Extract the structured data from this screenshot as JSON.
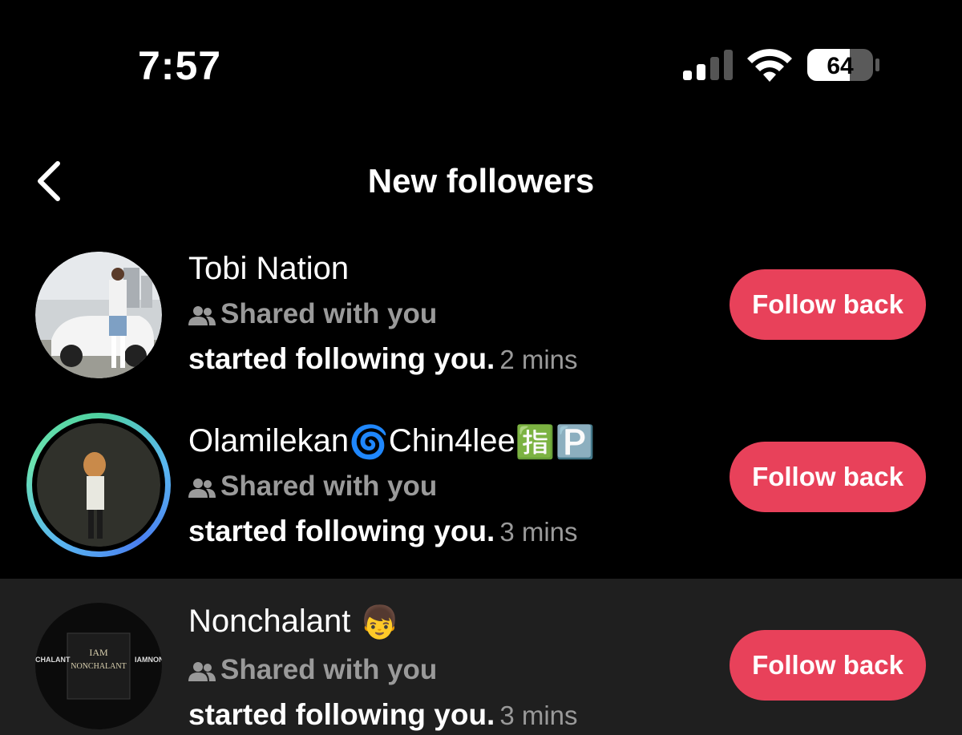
{
  "status_bar": {
    "time": "7:57",
    "battery_level": "64",
    "signal_icon": "cellular-signal-icon",
    "wifi_icon": "wifi-icon"
  },
  "header": {
    "title": "New followers",
    "back_icon": "chevron-left-icon"
  },
  "followers": [
    {
      "name": "Tobi Nation",
      "shared_label": "Shared with you",
      "activity": "started following you.",
      "time_ago": "2 mins",
      "button_label": "Follow back"
    },
    {
      "name": "Olamilekan",
      "name_emoji_1": "🌀",
      "name_part_2": "Chin4lee",
      "name_emoji_2": "🈯",
      "name_emoji_3": "🅿️",
      "shared_label": "Shared with you",
      "activity": "started following you.",
      "time_ago": "3 mins",
      "button_label": "Follow back"
    },
    {
      "name": "Nonchalant",
      "name_emoji_1": "👦",
      "shared_label": "Shared with you",
      "activity": "started following you.",
      "time_ago": "3 mins",
      "button_label": "Follow back",
      "avatar_text_1": "IAM",
      "avatar_text_2": "NONCHALANT",
      "avatar_text_left": "CHALANT",
      "avatar_text_right": "IAMNONI"
    }
  ],
  "colors": {
    "accent": "#e8415a",
    "background": "#000000",
    "highlight_row": "#1f1f1f",
    "muted_text": "#9a9a9a"
  }
}
